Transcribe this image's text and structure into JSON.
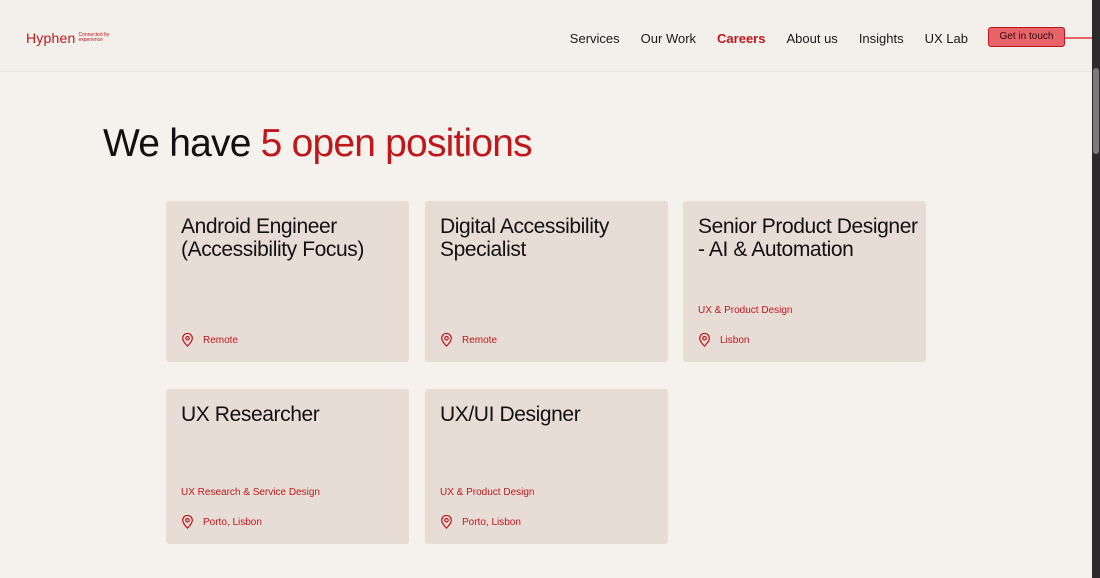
{
  "brand": {
    "name": "Hyphen",
    "tagline": "Connected by experience"
  },
  "nav": {
    "items": [
      {
        "label": "Services"
      },
      {
        "label": "Our Work"
      },
      {
        "label": "Careers"
      },
      {
        "label": "About us"
      },
      {
        "label": "Insights"
      },
      {
        "label": "UX Lab"
      }
    ],
    "active": "Careers",
    "cta_label": "Get in touch"
  },
  "headline": {
    "prefix": "We have ",
    "accent": "5 open positions"
  },
  "colors": {
    "accent": "#c0171b",
    "card_bg": "#e8ddd6",
    "page_bg": "#f5f1ed",
    "cta_bg": "#e8636a"
  },
  "jobs": [
    {
      "title": "Android Engineer (Accessibility Focus)",
      "department": "",
      "location": "Remote",
      "icon": "map-pin-icon"
    },
    {
      "title": "Digital Accessibility Specialist",
      "department": "",
      "location": "Remote",
      "icon": "map-pin-icon"
    },
    {
      "title": "Senior Product Designer - AI & Automation",
      "department": "UX & Product Design",
      "location": "Lisbon",
      "icon": "map-pin-icon"
    },
    {
      "title": "UX Researcher",
      "department": "UX Research & Service Design",
      "location": "Porto, Lisbon",
      "icon": "map-pin-icon"
    },
    {
      "title": "UX/UI Designer",
      "department": "UX & Product Design",
      "location": "Porto, Lisbon",
      "icon": "map-pin-icon"
    }
  ]
}
